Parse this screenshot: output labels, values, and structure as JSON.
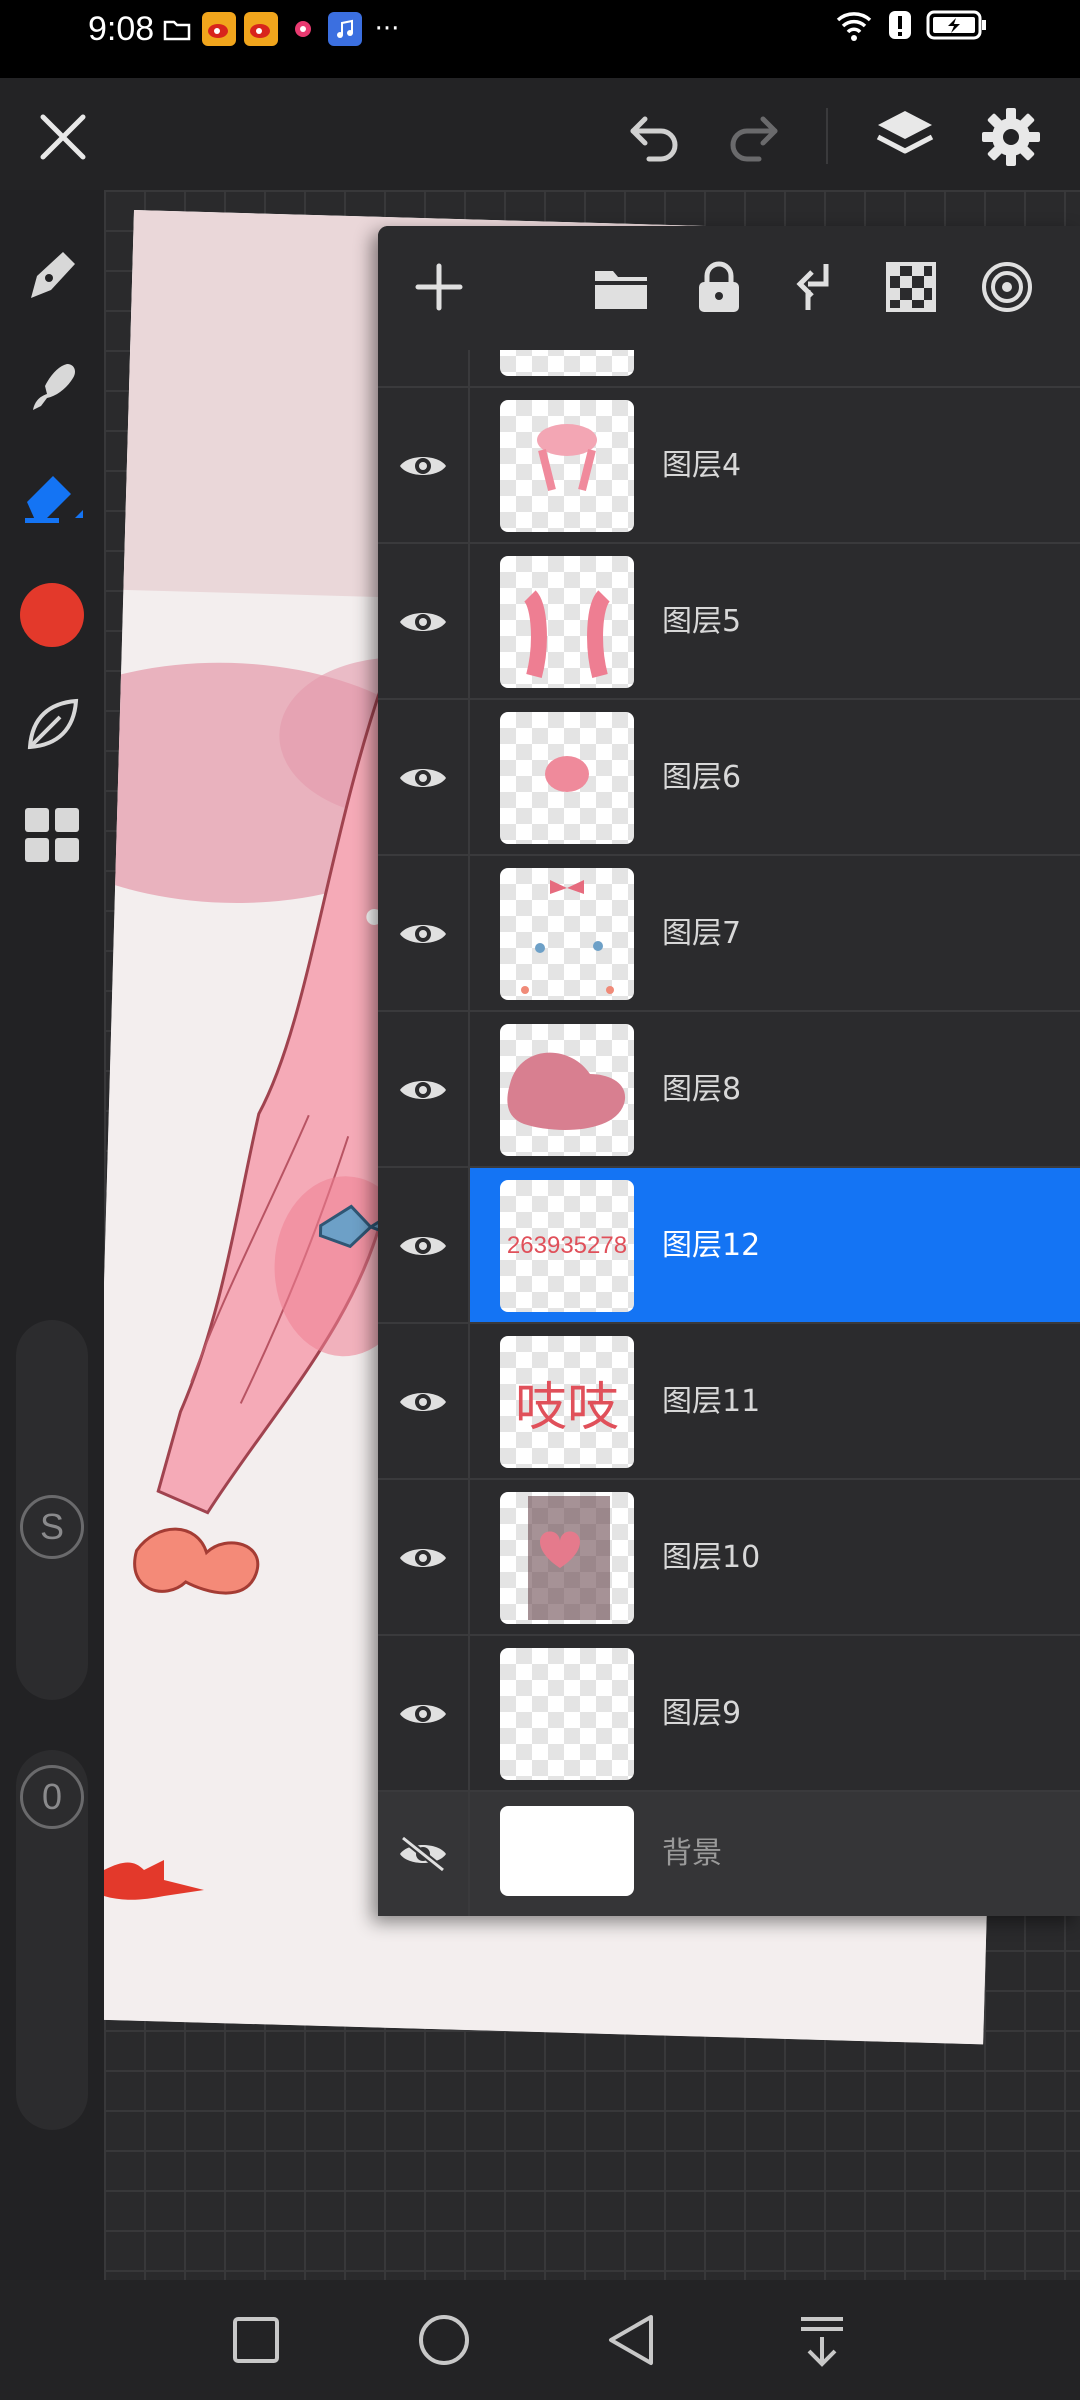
{
  "status_bar": {
    "time": "9:08",
    "more": "···"
  },
  "colors": {
    "accent": "#1474f4",
    "brush_color": "#e3392b",
    "panel_bg": "#2b2b2d"
  },
  "canvas": {
    "watermark_text": "吱吱",
    "watermark_number": "263935278"
  },
  "left_toolbar": {
    "tools": [
      "pen-icon",
      "smudge-icon",
      "eraser-icon",
      "color-swatch",
      "leaf-icon",
      "grid-icon"
    ],
    "size_label": "S",
    "opacity_label": "0"
  },
  "layers_panel": {
    "toolbar_icons": [
      "add-icon",
      "folder-icon",
      "lock-icon",
      "merge-down-icon",
      "transparency-icon",
      "target-icon"
    ],
    "layers": [
      {
        "name": "图层4",
        "visible": true,
        "selected": false
      },
      {
        "name": "图层5",
        "visible": true,
        "selected": false
      },
      {
        "name": "图层6",
        "visible": true,
        "selected": false
      },
      {
        "name": "图层7",
        "visible": true,
        "selected": false
      },
      {
        "name": "图层8",
        "visible": true,
        "selected": false
      },
      {
        "name": "图层12",
        "visible": true,
        "selected": true,
        "thumb_text": "263935278"
      },
      {
        "name": "图层11",
        "visible": true,
        "selected": false,
        "thumb_text": "吱吱"
      },
      {
        "name": "图层10",
        "visible": true,
        "selected": false
      },
      {
        "name": "图层9",
        "visible": true,
        "selected": false
      },
      {
        "name": "背景",
        "visible": false,
        "selected": false
      }
    ]
  }
}
